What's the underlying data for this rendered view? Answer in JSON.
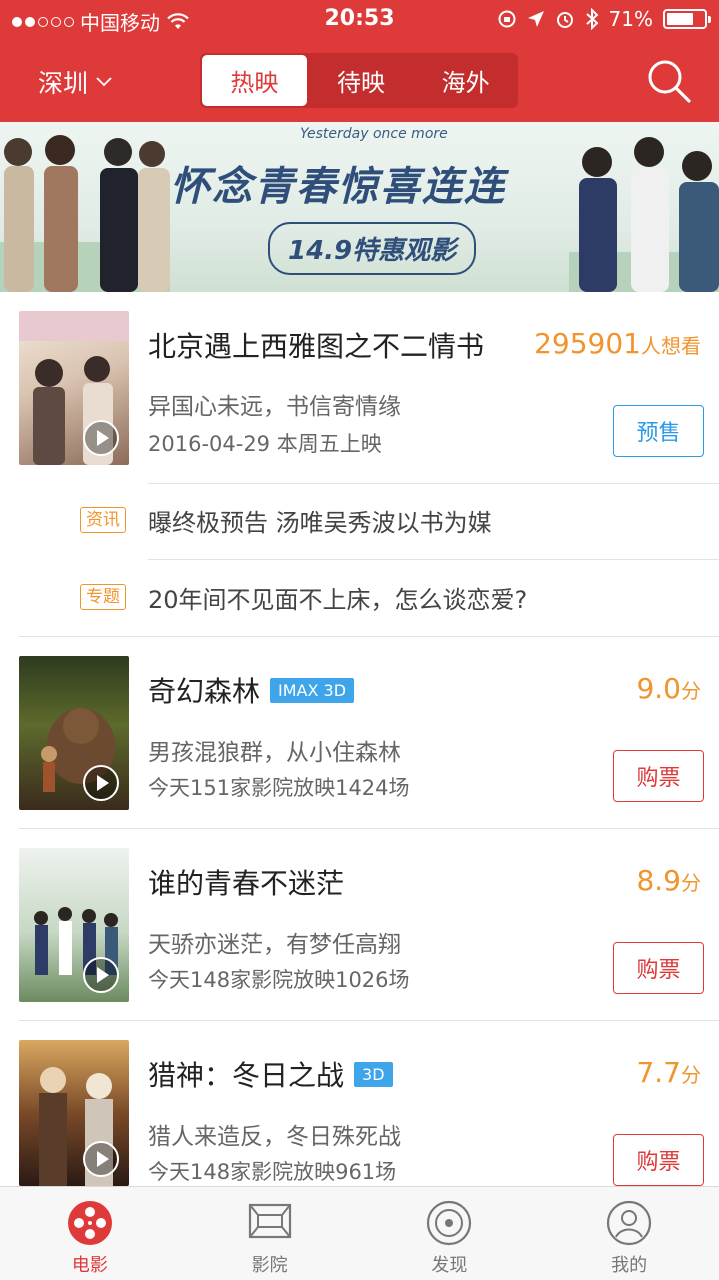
{
  "status_bar": {
    "carrier": "中国移动",
    "time": "20:53",
    "battery": "71%",
    "battery_level": 0.71,
    "icons": [
      "wifi-icon",
      "rotation-lock-icon",
      "location-arrow-icon",
      "alarm-icon",
      "bluetooth-icon",
      "battery-icon"
    ]
  },
  "header": {
    "city": "深圳",
    "tabs": [
      {
        "label": "热映",
        "active": true
      },
      {
        "label": "待映",
        "active": false
      },
      {
        "label": "海外",
        "active": false
      }
    ],
    "colors": {
      "brand": "#df3a3a",
      "tab_dark": "#c42d2d"
    }
  },
  "banner": {
    "english": "Yesterday once more",
    "title": "怀念青春惊喜连连",
    "subtitle": "14.9特惠观影"
  },
  "featured": {
    "title": "北京遇上西雅图之不二情书",
    "wish_count": "295901",
    "wish_unit": "人想看",
    "desc": "异国心未远，书信寄情缘",
    "release": "2016-04-29 本周五上映",
    "button": "预售",
    "news": [
      {
        "badge": "资讯",
        "text": "曝终极预告 汤唯吴秀波以书为媒"
      },
      {
        "badge": "专题",
        "text": "20年间不见面不上床，怎么谈恋爱?"
      }
    ]
  },
  "movies": [
    {
      "title": "奇幻森林",
      "tag": "IMAX 3D",
      "score": "9.0",
      "score_unit": "分",
      "desc": "男孩混狼群，从小住森林",
      "info": "今天151家影院放映1424场",
      "button": "购票"
    },
    {
      "title": "谁的青春不迷茫",
      "tag": "",
      "score": "8.9",
      "score_unit": "分",
      "desc": "天骄亦迷茫，有梦任高翔",
      "info": "今天148家影院放映1026场",
      "button": "购票"
    },
    {
      "title": "猎神：冬日之战",
      "tag": "3D",
      "score": "7.7",
      "score_unit": "分",
      "desc": "猎人来造反，冬日殊死战",
      "info": "今天148家影院放映961场",
      "button": "购票"
    }
  ],
  "tabbar": [
    {
      "label": "电影",
      "icon": "film-reel-icon",
      "active": true
    },
    {
      "label": "影院",
      "icon": "cinema-screen-icon",
      "active": false
    },
    {
      "label": "发现",
      "icon": "discover-compass-icon",
      "active": false
    },
    {
      "label": "我的",
      "icon": "profile-icon",
      "active": false
    }
  ],
  "colors": {
    "accent_orange": "#f1942e",
    "presale_blue": "#2b9be8",
    "tag_blue": "#3ea5ea"
  }
}
